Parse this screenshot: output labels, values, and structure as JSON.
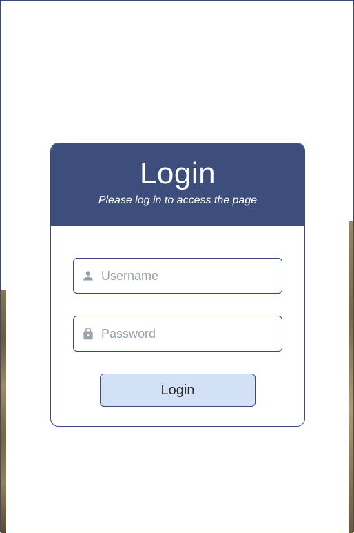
{
  "login": {
    "title": "Login",
    "subtitle": "Please log in to access the page",
    "username_placeholder": "Username",
    "password_placeholder": "Password",
    "button_label": "Login"
  }
}
